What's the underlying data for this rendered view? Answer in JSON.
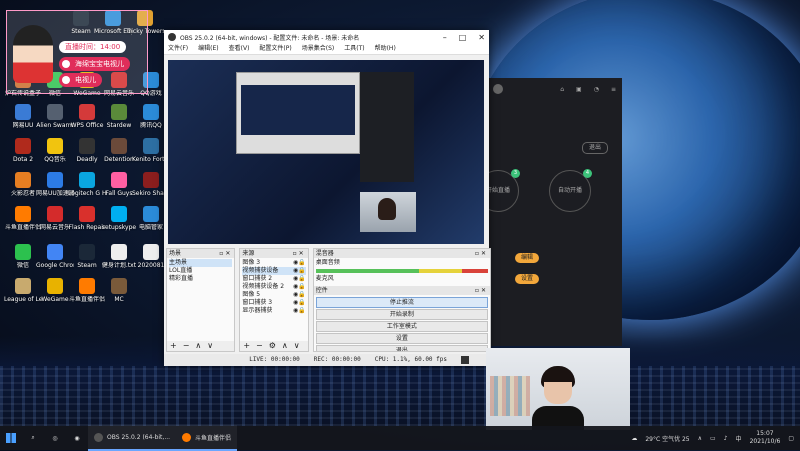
{
  "desktop": {
    "icons": [
      {
        "label": "Steam",
        "color": "#1b2838"
      },
      {
        "label": "Microsoft Edge",
        "color": "#2b8bd8"
      },
      {
        "label": "Tricky Towers",
        "color": "#e0a030"
      },
      {
        "label": "炉石传说盒子",
        "color": "#c96b2b"
      },
      {
        "label": "微信",
        "color": "#2cc14e"
      },
      {
        "label": "WeGame",
        "color": "#e8b200"
      },
      {
        "label": "网易云音乐",
        "color": "#d42b2b"
      },
      {
        "label": "QQ游戏",
        "color": "#2b8bd8"
      },
      {
        "label": "网易UU",
        "color": "#3a7bd5"
      },
      {
        "label": "Alien Swarm",
        "color": "#556070"
      },
      {
        "label": "WPS Office",
        "color": "#d43a3a"
      },
      {
        "label": "Stardew",
        "color": "#5a8a3a"
      },
      {
        "label": "腾讯QQ",
        "color": "#2b8bd8"
      },
      {
        "label": "Dota 2",
        "color": "#b02a1c"
      },
      {
        "label": "QQ音乐",
        "color": "#f1c40f"
      },
      {
        "label": "Deadly",
        "color": "#333"
      },
      {
        "label": "Detention",
        "color": "#6b4a3a"
      },
      {
        "label": "Kenito Fortune",
        "color": "#2d6fa3"
      },
      {
        "label": "火影忍者",
        "color": "#e67e22"
      },
      {
        "label": "网易UU加速器",
        "color": "#2c7be5"
      },
      {
        "label": "Logitech G HUB",
        "color": "#0aa6e0"
      },
      {
        "label": "Fall Guys",
        "color": "#ff5fa2"
      },
      {
        "label": "Sekiro Shadows",
        "color": "#8b1e1e"
      },
      {
        "label": "斗鱼直播伴侣",
        "color": "#ff7b00"
      },
      {
        "label": "网易云音乐",
        "color": "#d42b2b"
      },
      {
        "label": "Flash Repair",
        "color": "#d9302c"
      },
      {
        "label": "setupskype",
        "color": "#00aff0"
      },
      {
        "label": "电脑管家",
        "color": "#2b8bd8"
      },
      {
        "label": "微信",
        "color": "#2cc14e"
      },
      {
        "label": "Google Chrome",
        "color": "#4285f4"
      },
      {
        "label": "Steam",
        "color": "#1b2838"
      },
      {
        "label": "健身计划.txt",
        "color": "#eeeeee"
      },
      {
        "label": "2020081",
        "color": "#eeeeee"
      },
      {
        "label": "League of Legends",
        "color": "#c8aa6e"
      },
      {
        "label": "WeGame",
        "color": "#e8b200"
      },
      {
        "label": "斗鱼直播伴侣",
        "color": "#ff7b00"
      },
      {
        "label": "MC",
        "color": "#7a5a3a"
      }
    ]
  },
  "overlay": {
    "time_pill": "直播时间：14:00",
    "pill_1": "海绵宝宝电视儿",
    "pill_2": "电视儿"
  },
  "obs": {
    "title": "OBS 25.0.2 (64-bit, windows) - 配置文件: 未命名 - 场景: 未命名",
    "menu": [
      "文件(F)",
      "编辑(E)",
      "查看(V)",
      "配置文件(P)",
      "场景集合(S)",
      "工具(T)",
      "帮助(H)"
    ],
    "docks": {
      "scenes": {
        "header": "场景",
        "items": [
          "主场景",
          "LOL直播",
          "精彩直播"
        ]
      },
      "sources": {
        "header": "来源",
        "items": [
          "图像 3",
          "视频捕获设备",
          "窗口捕获 2",
          "视频捕获设备 2",
          "图像 5",
          "窗口捕获 3",
          "显示器捕获"
        ]
      },
      "mixer": {
        "header": "混音器",
        "track_1": "桌面音频",
        "track_2": "麦克风"
      },
      "controls": {
        "header": "控件",
        "buttons": [
          "停止推流",
          "开始录制",
          "工作室模式",
          "设置",
          "退出"
        ]
      }
    },
    "status": {
      "live": "LIVE: 00:00:00",
      "rec": "REC: 00:00:00",
      "cpu": "CPU: 1.1%, 60.00 fps"
    }
  },
  "darkapp": {
    "circle_1": "开始直播",
    "circle_2": "自动开播",
    "badge_1": "3",
    "badge_2": "4",
    "exit_label": "退出",
    "btn_1": "编辑",
    "btn_2": "设置"
  },
  "taskbar": {
    "apps": [
      {
        "label": "OBS 25.0.2 (64-bit,...",
        "color": "#555"
      },
      {
        "label": "斗鱼直播伴侣",
        "color": "#ff7b00"
      }
    ],
    "weather": "29°C 空气优 25",
    "time": "15:07",
    "date": "2021/10/6"
  }
}
